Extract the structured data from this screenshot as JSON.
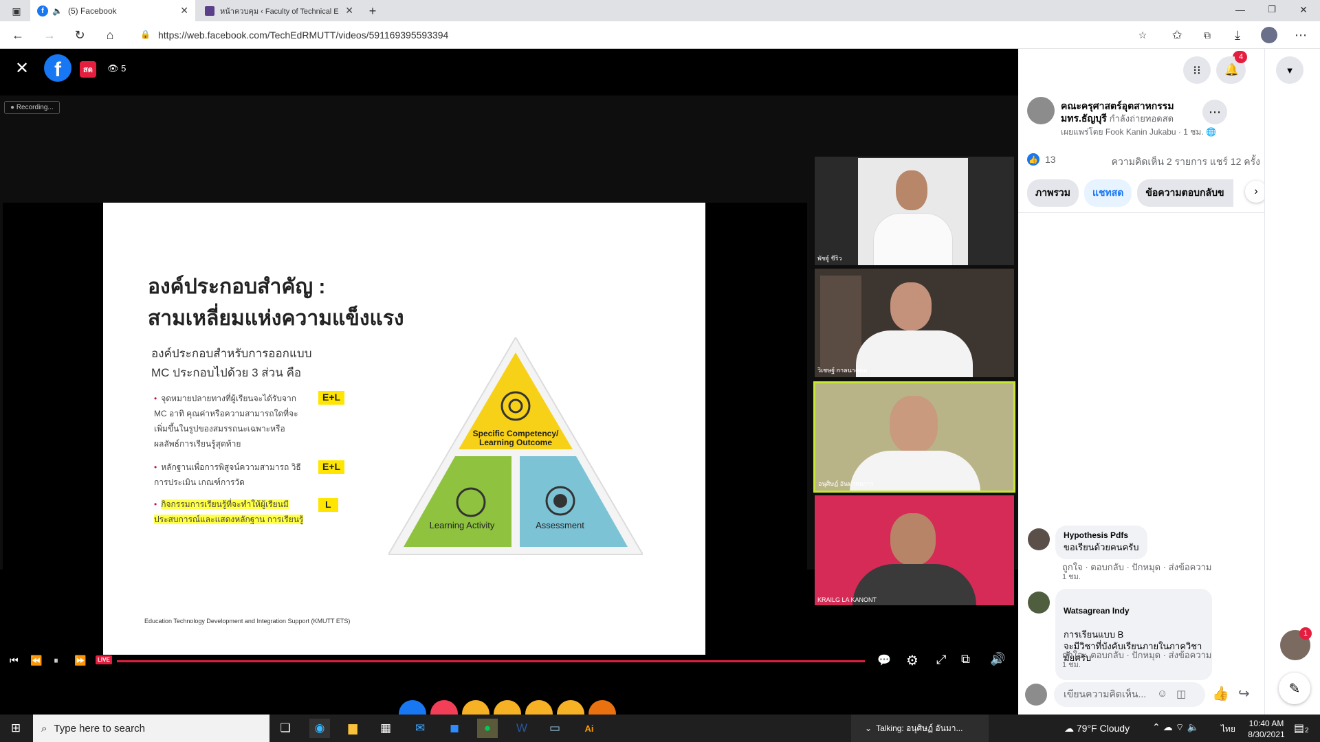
{
  "browser": {
    "tabs": [
      {
        "title": "(5) Facebook",
        "active": true
      },
      {
        "title": "หน้าควบคุม ‹ Faculty of Technical E",
        "active": false
      }
    ],
    "url": "https://web.facebook.com/TechEdRMUTT/videos/591169395593394"
  },
  "video": {
    "live_badge": "สด",
    "viewers": "5",
    "recording_label": "Recording...",
    "controls_live": "LIVE",
    "participants": [
      {
        "name": "พัชฐู์ ชีริว"
      },
      {
        "name": "วิเชษฐ์ กาลนาคดม"
      },
      {
        "name": "อนุศิษฏ์ อันมาทยการ"
      },
      {
        "name": "KRAILG LA KANONT"
      }
    ]
  },
  "slide": {
    "title_line1": "องค์ประกอบสำคัญ :",
    "title_line2": "สามเหลี่ยมแห่งความแข็งแรง",
    "intro_line1": "องค์ประกอบสำหรับการออกแบบ",
    "intro_line2": "MC ประกอบไปด้วย 3 ส่วน คือ",
    "bullets": [
      {
        "text": "จุดหมายปลายทางที่ผู้เรียนจะได้รับจาก MC อาทิ คุณค่าหรือความสามารถใดที่จะเพิ่มขึ้นในรูปของสมรรถนะเฉพาะหรือผลลัพธ์การเรียนรู้สุดท้าย",
        "tag": "E+L"
      },
      {
        "text": "หลักฐานเพื่อการพิสูจน์ความสามารถ วิธีการประเมิน เกณฑ์การวัด",
        "tag": "E+L"
      },
      {
        "text": "กิจกรรมการเรียนรู้ที่จะทำให้ผู้เรียนมีประสบการณ์และแสดงหลักฐาน การเรียนรู้",
        "tag": "L"
      }
    ],
    "triangle": {
      "top": "Specific Competency/ Learning Outcome",
      "left": "Learning Activity",
      "right": "Assessment"
    },
    "footer": "Education Technology Development and Integration Support (KMUTT ETS)"
  },
  "sidebar": {
    "page_name_line1": "คณะครุศาสตร์อุตสาหกรรม",
    "page_name_line2": "มทร.ธัญบุรี",
    "status": "กำลังถ่ายทอดสด",
    "shared_by": "เผยแพร่โดย Fook Kanin Jukabu",
    "time": "1 ชม.",
    "likes": "13",
    "comments_shares": "ความคิดเห็น 2 รายการ  แชร์ 12 ครั้ง",
    "tabs": [
      "ภาพรวม",
      "แชทสด",
      "ข้อความตอบกลับข"
    ],
    "comments": [
      {
        "author": "Hypothesis Pdfs",
        "text": "ขอเรียนด้วยคนครับ",
        "actions": "ถูกใจ · ตอบกลับ · ปักหมุด · ส่งข้อความ",
        "time": "1 ชม."
      },
      {
        "author": "Watsagrean Indy",
        "text": "การเรียนแบบ B\nจะมีวิชาที่บังคับเรียนภายในภาควิชา\nมั้ยครับ",
        "actions": "ถูกใจ · ตอบกลับ · ปักหมุด · ส่งข้อความ",
        "time": "1 ชม."
      }
    ],
    "comment_placeholder": "เขียนความคิดเห็น...",
    "messenger_badge": "1",
    "notif_badge": "4",
    "chat_badge": "1"
  },
  "taskbar": {
    "search_placeholder": "Type here to search",
    "talking": "Talking: อนุศิษฏ์ อันมา...",
    "weather": "79°F  Cloudy",
    "lang": "ไทย",
    "time": "10:40 AM",
    "date": "8/30/2021",
    "notif_count": "2"
  }
}
